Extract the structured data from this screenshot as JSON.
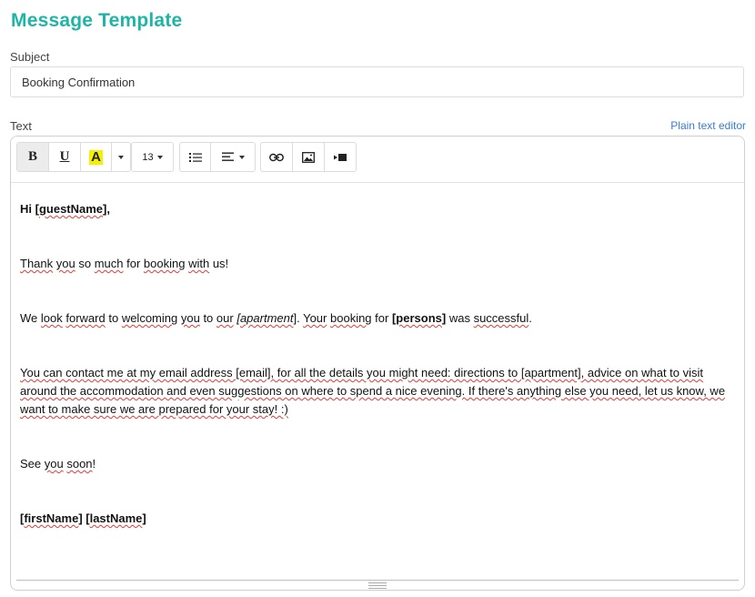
{
  "page": {
    "title": "Message Template",
    "accent_color": "#1fb5a6",
    "link_color": "#3a7bd5",
    "spellcheck_color": "#e53935"
  },
  "subject": {
    "label": "Subject",
    "value": "Booking Confirmation"
  },
  "text": {
    "label": "Text",
    "plain_text_link": "Plain text editor"
  },
  "toolbar": {
    "bold": "B",
    "underline": "U",
    "highlight": "A",
    "highlight_color": "#f5f000",
    "font_size": "13",
    "icons": [
      "bold-icon",
      "underline-icon",
      "highlight-icon",
      "unordered-list-icon",
      "align-icon",
      "link-icon",
      "image-icon",
      "video-icon"
    ]
  },
  "body": {
    "p1": {
      "t1": "Hi [",
      "t2": "guestName",
      "t3": "],"
    },
    "p2": {
      "t1": "Thank",
      "t2": " ",
      "t3": "you",
      "t4": " so ",
      "t5": "much",
      "t6": " for ",
      "t7": "booking",
      "t8": " ",
      "t9": "with",
      "t10": " us!"
    },
    "p3": {
      "t1": "We ",
      "t2": "look",
      "t3": " ",
      "t4": "forward",
      "t5": " to ",
      "t6": "welcoming",
      "t7": " ",
      "t8": "you",
      "t9": " to ",
      "t10": "our",
      "t11": " [",
      "t12": "apartment",
      "t13": "]. ",
      "t14": "Your",
      "t15": " ",
      "t16": "booking",
      "t17": " for ",
      "t18": "[",
      "t19": "persons",
      "t20": "]",
      "t21": " was ",
      "t22": "successful",
      "t23": "."
    },
    "p4": "You can contact me at my email address [email], for all the details you might need: directions to [apartment], advice on what to visit around the accommodation and even suggestions on where to spend a nice evening. If there's anything else you need, let us know, we want to make sure we are prepared for your stay! :)",
    "p5": {
      "t1": "See ",
      "t2": "you",
      "t3": " ",
      "t4": "soon",
      "t5": "!"
    },
    "p6": {
      "t1": "[",
      "t2": "firstName",
      "t3": "] [",
      "t4": "lastName",
      "t5": "]"
    }
  }
}
